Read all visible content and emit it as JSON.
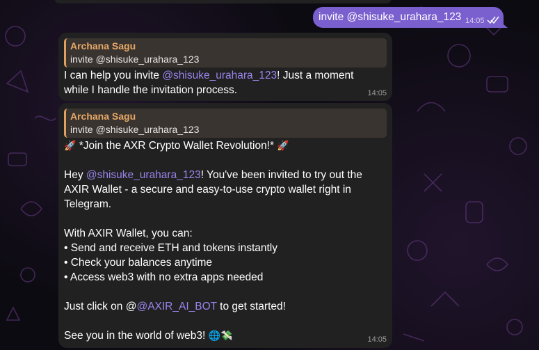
{
  "outgoing": {
    "text": "invite @shisuke_urahara_123",
    "time": "14:05"
  },
  "message1": {
    "reply_name": "Archana Sagu",
    "reply_text": "invite @shisuke_urahara_123",
    "prefix": "I can help you invite ",
    "mention": "@shisuke_urahara_123",
    "suffix": "! Just a moment",
    "line2": "while I handle the invitation process.",
    "time": "14:05"
  },
  "message2": {
    "reply_name": "Archana Sagu",
    "reply_text": "invite @shisuke_urahara_123",
    "headline_emoji_left": "🚀",
    "headline": " *Join the AXR Crypto Wallet Revolution!* ",
    "headline_emoji_right": "🚀",
    "hey_prefix": "Hey ",
    "hey_mention": "@shisuke_urahara_123",
    "hey_suffix": "! You've been invited to try out the",
    "hey_line2": "AXIR Wallet - a secure and easy-to-use crypto wallet right in",
    "hey_line3": "Telegram.",
    "features_intro": "With AXIR Wallet, you can:",
    "features": [
      "• Send and receive ETH and tokens instantly",
      "• Check your balances anytime",
      "• Access web3 with no extra apps needed"
    ],
    "cta_prefix": "Just click on @",
    "cta_link": "@AXIR_AI_BOT",
    "cta_suffix": " to get started!",
    "closing": "See you in the world of web3! ",
    "closing_emoji": "🌐💸",
    "time": "14:05"
  }
}
